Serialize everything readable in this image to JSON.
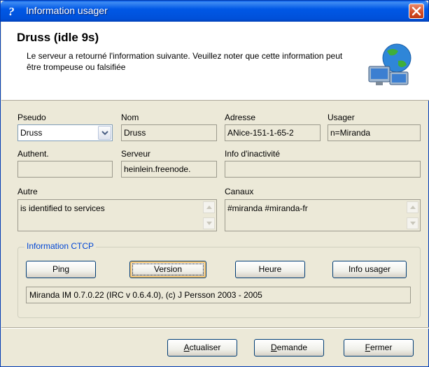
{
  "window": {
    "title": "Information usager",
    "close_icon": "close-icon",
    "app_icon": "help-question-icon"
  },
  "header": {
    "title": "Druss (idle 9s)",
    "description": "Le serveur a retourné l'information suivante. Veuillez noter que cette information peut être trompeuse ou falsifiée",
    "icon": "network-globe-icon"
  },
  "fields": {
    "pseudo": {
      "label": "Pseudo",
      "value": "Druss"
    },
    "nom": {
      "label": "Nom",
      "value": "Druss"
    },
    "adresse": {
      "label": "Adresse",
      "value": "ANice-151-1-65-2"
    },
    "usager": {
      "label": "Usager",
      "value": "n=Miranda"
    },
    "authent": {
      "label": "Authent.",
      "value": ""
    },
    "serveur": {
      "label": "Serveur",
      "value": "heinlein.freenode."
    },
    "inactivite": {
      "label": "Info d'inactivité",
      "value": ""
    },
    "autre": {
      "label": "Autre",
      "value": "is identified to services"
    },
    "canaux": {
      "label": "Canaux",
      "value": "#miranda #miranda-fr"
    }
  },
  "ctcp": {
    "legend": "Information CTCP",
    "buttons": {
      "ping": "Ping",
      "version": "Version",
      "heure": "Heure",
      "info_usager": "Info usager"
    },
    "result": "Miranda IM 0.7.0.22 (IRC v 0.6.4.0), (c) J Persson 2003 - 2005"
  },
  "footer": {
    "actualiser_first": "A",
    "actualiser_rest": "ctualiser",
    "demande_first": "D",
    "demande_rest": "emande",
    "fermer_first": "F",
    "fermer_rest": "ermer"
  },
  "colors": {
    "titlebar": "#0058e6",
    "accent": "#0046d5",
    "close": "#d24a24"
  }
}
